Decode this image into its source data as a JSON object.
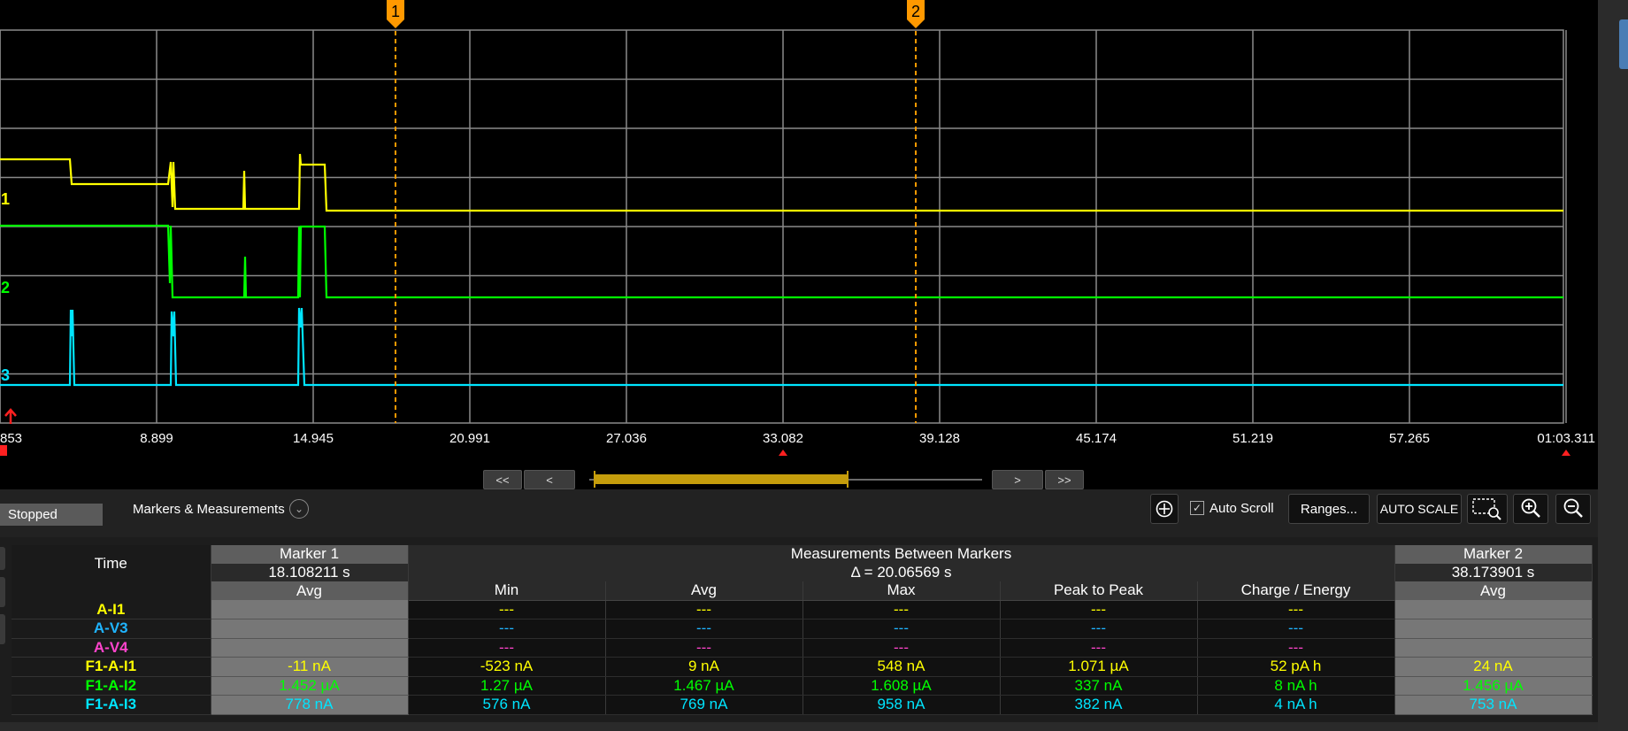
{
  "status": "Stopped",
  "panel_title": "Markers & Measurements",
  "toolbar": {
    "auto_scroll_label": "Auto Scroll",
    "auto_scroll_checked": true,
    "ranges_label": "Ranges...",
    "autoscale_label": "AUTO SCALE"
  },
  "navigation": {
    "first": "<<",
    "prev": "<",
    "next": ">",
    "last": ">>"
  },
  "chart_data": {
    "type": "line",
    "x_tick_labels": [
      "853",
      "8.899",
      "14.945",
      "20.991",
      "27.036",
      "33.082",
      "39.128",
      "45.174",
      "51.219",
      "57.265",
      "01:03.311"
    ],
    "grid": true,
    "series": [
      {
        "name": "I1",
        "color": "#ffff00"
      },
      {
        "name": "I2",
        "color": "#00ff00"
      },
      {
        "name": "I3",
        "color": "#00e5ff"
      }
    ],
    "markers": [
      {
        "label": "1",
        "time": "18.108211 s"
      },
      {
        "label": "2",
        "time": "38.173901 s"
      }
    ],
    "marker_color": "#ff9900"
  },
  "table": {
    "time_label": "Time",
    "marker1": {
      "title": "Marker 1",
      "time": "18.108211 s",
      "col": "Avg"
    },
    "between": {
      "title": "Measurements Between Markers",
      "delta": "Δ = 20.06569 s"
    },
    "marker2": {
      "title": "Marker 2",
      "time": "38.173901 s",
      "col": "Avg"
    },
    "columns": [
      "Min",
      "Avg",
      "Max",
      "Peak to Peak",
      "Charge / Energy"
    ],
    "rows": [
      {
        "label": "A-I1",
        "color": "#ffff00",
        "m1": "",
        "values": [
          "---",
          "---",
          "---",
          "---",
          "---"
        ],
        "m2": ""
      },
      {
        "label": "A-V3",
        "color": "#1fb4ff",
        "m1": "",
        "values": [
          "---",
          "---",
          "---",
          "---",
          "---"
        ],
        "m2": ""
      },
      {
        "label": "A-V4",
        "color": "#ff44cc",
        "m1": "",
        "values": [
          "---",
          "---",
          "---",
          "---",
          "---"
        ],
        "m2": ""
      },
      {
        "label": "F1-A-I1",
        "color": "#ffff00",
        "m1": "-11 nA",
        "values": [
          "-523 nA",
          "9 nA",
          "548 nA",
          "1.071 µA",
          "52 pA h"
        ],
        "m2": "24 nA"
      },
      {
        "label": "F1-A-I2",
        "color": "#00ff00",
        "m1": "1.452 µA",
        "values": [
          "1.27 µA",
          "1.467 µA",
          "1.608 µA",
          "337 nA",
          "8 nA h"
        ],
        "m2": "1.456 µA"
      },
      {
        "label": "F1-A-I3",
        "color": "#00e5ff",
        "m1": "778 nA",
        "values": [
          "576 nA",
          "769 nA",
          "958 nA",
          "382 nA",
          "4 nA h"
        ],
        "m2": "753 nA"
      }
    ]
  }
}
